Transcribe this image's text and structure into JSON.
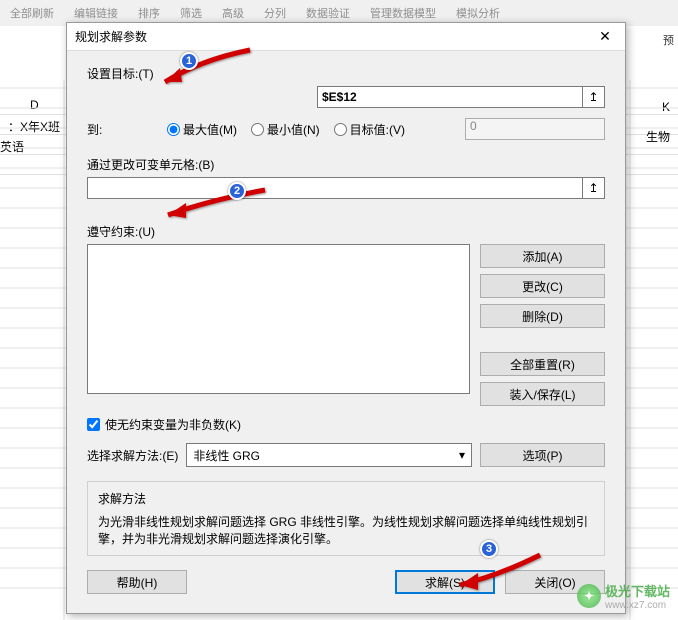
{
  "ribbon": {
    "items": [
      "全部刷新",
      "编辑链接",
      "排序",
      "筛选",
      "高级",
      "分列",
      "数据验证",
      "管理数据模型",
      "模拟分析"
    ]
  },
  "preview_label": "预",
  "sheet": {
    "col_d": "D",
    "col_k": "K",
    "row1_a": "：X年X班",
    "row2_a": "英语",
    "right_k": "K",
    "right_bio": "生物"
  },
  "dialog": {
    "title": "规划求解参数",
    "close": "✕",
    "set_target_label": "设置目标:(T)",
    "set_target_value": "$E$12",
    "to_label": "到:",
    "radios": {
      "max": "最大值(M)",
      "min": "最小值(N)",
      "target": "目标值:(V)"
    },
    "target_num": "0",
    "change_cells_label": "通过更改可变单元格:(B)",
    "constraints_label": "遵守约束:(U)",
    "buttons": {
      "add": "添加(A)",
      "change": "更改(C)",
      "delete": "删除(D)",
      "reset": "全部重置(R)",
      "loadsave": "装入/保存(L)",
      "options": "选项(P)",
      "help": "帮助(H)",
      "solve": "求解(S)",
      "close": "关闭(O)"
    },
    "unconstrained_chk": "使无约束变量为非负数(K)",
    "method_label": "选择求解方法:(E)",
    "method_value": "非线性 GRG",
    "desc_title": "求解方法",
    "desc_text": "为光滑非线性规划求解问题选择 GRG 非线性引擎。为线性规划求解问题选择单纯线性规划引擎，并为非光滑规划求解问题选择演化引擎。"
  },
  "watermark": {
    "brand": "极光下载站",
    "url": "www.xz7.com"
  }
}
